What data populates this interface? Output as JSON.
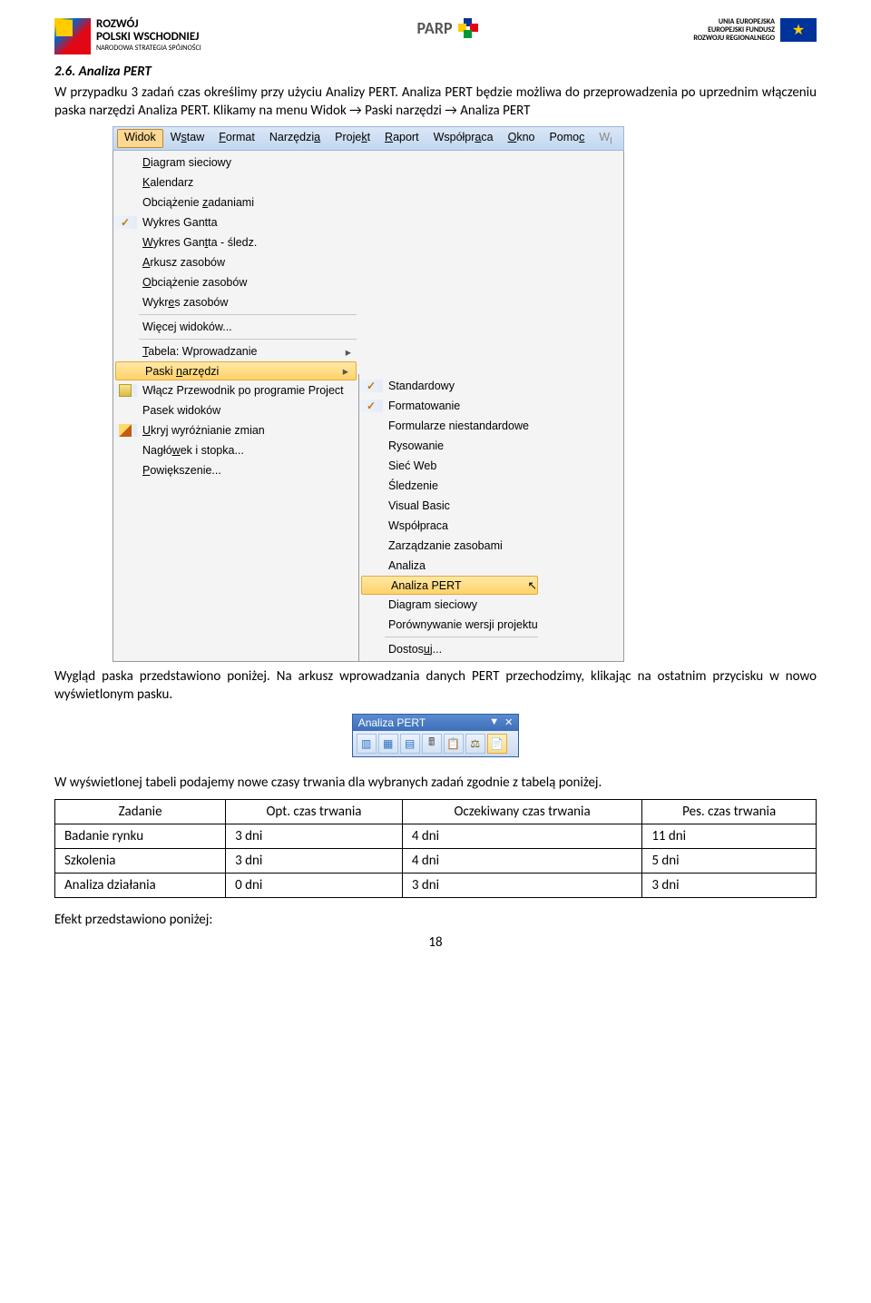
{
  "header": {
    "left": {
      "line1": "ROZWÓJ",
      "line2": "POLSKI WSCHODNIEJ",
      "line3": "NARODOWA STRATEGIA SPÓJNOŚCI"
    },
    "center": "PARP",
    "right": {
      "line1": "UNIA EUROPEJSKA",
      "line2": "EUROPEJSKI FUNDUSZ",
      "line3": "ROZWOJU REGIONALNEGO"
    }
  },
  "section_title": "2.6. Analiza PERT",
  "para1": "W przypadku 3 zadań czas określimy przy użyciu Analizy PERT. Analiza PERT będzie możliwa do przeprowadzenia po uprzednim włączeniu paska narzędzi Analiza PERT. Klikamy na menu Widok → Paski narzędzi → Analiza PERT",
  "menubar": [
    "Widok",
    "Wstaw",
    "Format",
    "Narzędzia",
    "Projekt",
    "Raport",
    "Współpraca",
    "Okno",
    "Pomoc"
  ],
  "menu1": [
    {
      "label": "Diagram sieciowy",
      "letter": "D"
    },
    {
      "label": "Kalendarz",
      "letter": "K"
    },
    {
      "label": "Obciążenie zadaniami",
      "letter": "z"
    },
    {
      "label": "Wykres Gantta",
      "letter": "",
      "checked": true
    },
    {
      "label": "Wykres Gantta - śledz.",
      "letter": "W"
    },
    {
      "label": "Arkusz zasobów",
      "letter": "A"
    },
    {
      "label": "Obciążenie zasobów",
      "letter": "O"
    },
    {
      "label": "Wykres zasobów",
      "letter": "e"
    },
    {
      "sep": true
    },
    {
      "label": "Więcej widoków...",
      "letter": ""
    },
    {
      "sep": true
    },
    {
      "label": "Tabela: Wprowadzanie",
      "letter": "T",
      "arrow": true
    },
    {
      "label": "Paski narzędzi",
      "letter": "n",
      "arrow": true,
      "hl": true
    },
    {
      "label": "Włącz Przewodnik po programie Project",
      "icon": "guide"
    },
    {
      "label": "Pasek widoków",
      "letter": ""
    },
    {
      "label": "Ukryj wyróżnianie zmian",
      "letter": "U",
      "icon": "pencil"
    },
    {
      "label": "Nagłówek i stopka...",
      "letter": "w"
    },
    {
      "label": "Powiększenie...",
      "letter": "P"
    }
  ],
  "menu2": [
    {
      "label": "Standardowy",
      "checked": true
    },
    {
      "label": "Formatowanie",
      "checked": true
    },
    {
      "label": "Formularze niestandardowe"
    },
    {
      "label": "Rysowanie"
    },
    {
      "label": "Sieć Web"
    },
    {
      "label": "Śledzenie"
    },
    {
      "label": "Visual Basic"
    },
    {
      "label": "Współpraca"
    },
    {
      "label": "Zarządzanie zasobami"
    },
    {
      "label": "Analiza"
    },
    {
      "label": "Analiza PERT",
      "hl": true
    },
    {
      "label": "Diagram sieciowy"
    },
    {
      "label": "Porównywanie wersji projektu"
    },
    {
      "sep": true
    },
    {
      "label": "Dostosuj...",
      "letter": "u"
    }
  ],
  "para2": "Wygląd paska przedstawiono poniżej. Na arkusz wprowadzania danych PERT przechodzimy, klikając na ostatnim przycisku w nowo wyświetlonym pasku.",
  "toolbar_title": "Analiza PERT",
  "para3": "W wyświetlonej tabeli podajemy nowe czasy trwania dla wybranych zadań zgodnie z tabelą poniżej.",
  "table": {
    "headers": [
      "Zadanie",
      "Opt. czas trwania",
      "Oczekiwany czas trwania",
      "Pes. czas trwania"
    ],
    "rows": [
      [
        "Badanie rynku",
        "3 dni",
        "4 dni",
        "11 dni"
      ],
      [
        "Szkolenia",
        "3 dni",
        "4 dni",
        "5 dni"
      ],
      [
        "Analiza działania",
        "0 dni",
        "3 dni",
        "3 dni"
      ]
    ]
  },
  "para4": "Efekt przedstawiono poniżej:",
  "page_number": "18"
}
